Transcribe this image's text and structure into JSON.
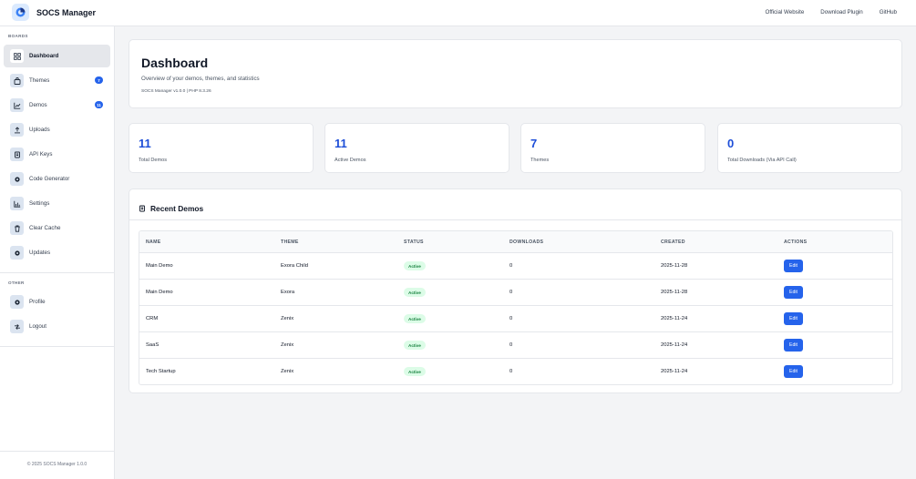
{
  "app": {
    "title": "SOCS Manager"
  },
  "topnav": {
    "official_website": "Official Website",
    "download_plugin": "Download Plugin",
    "github": "GitHub"
  },
  "sidebar": {
    "boards_label": "BOARDS",
    "items": [
      {
        "label": "Dashboard",
        "icon": "grid-icon",
        "active": true
      },
      {
        "label": "Themes",
        "icon": "bag-icon",
        "badge": "7"
      },
      {
        "label": "Demos",
        "icon": "chart-line-icon",
        "badge": "11"
      },
      {
        "label": "Uploads",
        "icon": "upload-icon"
      },
      {
        "label": "API Keys",
        "icon": "key-icon"
      },
      {
        "label": "Code Generator",
        "icon": "code-icon"
      },
      {
        "label": "Settings",
        "icon": "bar-chart-icon"
      },
      {
        "label": "Clear Cache",
        "icon": "trash-icon"
      },
      {
        "label": "Updates",
        "icon": "refresh-icon"
      }
    ],
    "other_label": "OTHER",
    "other_items": [
      {
        "label": "Profile",
        "icon": "user-icon"
      },
      {
        "label": "Logout",
        "icon": "logout-icon"
      }
    ],
    "footer": "© 2025 SOCS Manager   1.0.0"
  },
  "dashboard": {
    "title": "Dashboard",
    "subtitle": "Overview of your demos, themes, and statistics",
    "version": "SOCS Manager v1.0.0 | PHP 8.3.26"
  },
  "stats": [
    {
      "value": "11",
      "label": "Total Demos"
    },
    {
      "value": "11",
      "label": "Active Demos"
    },
    {
      "value": "7",
      "label": "Themes"
    },
    {
      "value": "0",
      "label": "Total Downloads (Via API Call)"
    }
  ],
  "recent": {
    "title": "Recent Demos",
    "columns": [
      "NAME",
      "THEME",
      "STATUS",
      "DOWNLOADS",
      "CREATED",
      "ACTIONS"
    ],
    "rows": [
      {
        "name": "Main Demo",
        "theme": "Exora Child",
        "status": "Active",
        "downloads": "0",
        "created": "2025-11-28",
        "action": "Edit"
      },
      {
        "name": "Main Demo",
        "theme": "Exora",
        "status": "Active",
        "downloads": "0",
        "created": "2025-11-28",
        "action": "Edit"
      },
      {
        "name": "CRM",
        "theme": "Zenix",
        "status": "Active",
        "downloads": "0",
        "created": "2025-11-24",
        "action": "Edit"
      },
      {
        "name": "SaaS",
        "theme": "Zenix",
        "status": "Active",
        "downloads": "0",
        "created": "2025-11-24",
        "action": "Edit"
      },
      {
        "name": "Tech Startup",
        "theme": "Zenix",
        "status": "Active",
        "downloads": "0",
        "created": "2025-11-24",
        "action": "Edit"
      }
    ]
  },
  "colors": {
    "accent": "#2563eb",
    "status_active_bg": "#dcfce7",
    "status_active_text": "#15803d"
  }
}
